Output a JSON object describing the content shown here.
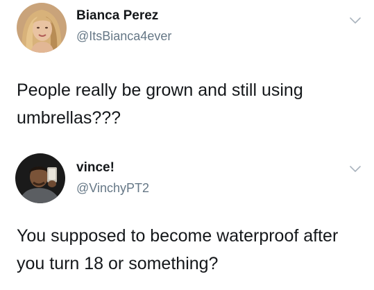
{
  "tweets": [
    {
      "display_name": "Bianca Perez",
      "handle": "@ItsBianca4ever",
      "text": "People really be grown and still using umbrellas???",
      "avatar_icon": "profile-photo-woman",
      "menu_icon": "chevron-down-icon"
    },
    {
      "display_name": "vince!",
      "handle": "@VinchyPT2",
      "text": "You supposed to become waterproof after you turn 18 or something?",
      "avatar_icon": "profile-photo-mirror-selfie",
      "menu_icon": "chevron-down-icon"
    }
  ],
  "colors": {
    "text_primary": "#14171a",
    "text_secondary": "#657786",
    "chevron": "#a9b3bd",
    "background": "#ffffff"
  }
}
